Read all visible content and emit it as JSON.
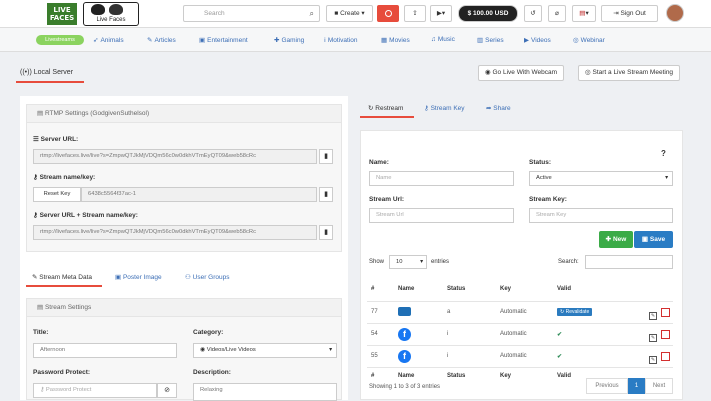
{
  "header": {
    "search_placeholder": "Search",
    "create_label": "Create",
    "balance": "$ 100.00 USD",
    "signout_label": "Sign Out"
  },
  "nav": {
    "pill": "Livestreams",
    "items": [
      "Animals",
      "Articles",
      "Entertainment",
      "Gaming",
      "Motivation",
      "Movies",
      "Music",
      "Series",
      "Videos",
      "Webinar"
    ]
  },
  "page": {
    "tab_label": "Local Server",
    "webcam_button": "Go Live With Webcam",
    "meeting_button": "Start a Live Stream Meeting"
  },
  "rtmp": {
    "title": "RTMP Settings (GodgivenSuthelsol)",
    "server_url_label": "Server URL:",
    "server_url": "rtmp://livefaces.live/live?s=ZmpwQTJkMjVDQm56c0w0dkhVTmEyQT09&web58cRc",
    "stream_key_label": "Stream name/key:",
    "reset_key": "Reset Key",
    "stream_key": "6438c5564f37ac-1",
    "combined_label": "Server URL + Stream name/key:",
    "combined": "rtmp://livefaces.live/live?s=ZmpwQTJkMjVDQm56c0w0dkhVTmEyQT09&web58cRc"
  },
  "subtabs": [
    "Stream Meta Data",
    "Poster Image",
    "User Groups"
  ],
  "stream_settings": {
    "title": "Stream Settings",
    "title_label": "Title:",
    "title_value": "Afternoon",
    "category_label": "Category:",
    "category_value": "Videos/Live Videos",
    "password_label": "Password Protect:",
    "password_placeholder": "Password Protect",
    "description_label": "Description:",
    "description_value": "Relaxing"
  },
  "right_tabs": [
    "Restream",
    "Stream Key",
    "Share"
  ],
  "restream": {
    "name_label": "Name:",
    "name_placeholder": "Name",
    "status_label": "Status:",
    "status_value": "Active",
    "url_label": "Stream Url:",
    "url_placeholder": "Stream Url",
    "key_label": "Stream Key:",
    "key_placeholder": "Stream Key",
    "new_button": "New",
    "save_button": "Save",
    "show_label": "Show",
    "show_value": "10",
    "entries_label": "entries",
    "search_label": "Search:",
    "columns": [
      "#",
      "Name",
      "Status",
      "Key",
      "Valid"
    ],
    "rows": [
      {
        "id": "77",
        "icon": "youtube",
        "status": "a",
        "key": "Automatic",
        "valid": "Revalidate"
      },
      {
        "id": "54",
        "icon": "facebook",
        "status": "i",
        "key": "Automatic",
        "valid": "check"
      },
      {
        "id": "55",
        "icon": "facebook",
        "status": "i",
        "key": "Automatic",
        "valid": "check"
      }
    ],
    "footer": "Showing 1 to 3 of 3 entries",
    "prev": "Previous",
    "page": "1",
    "next": "Next"
  }
}
